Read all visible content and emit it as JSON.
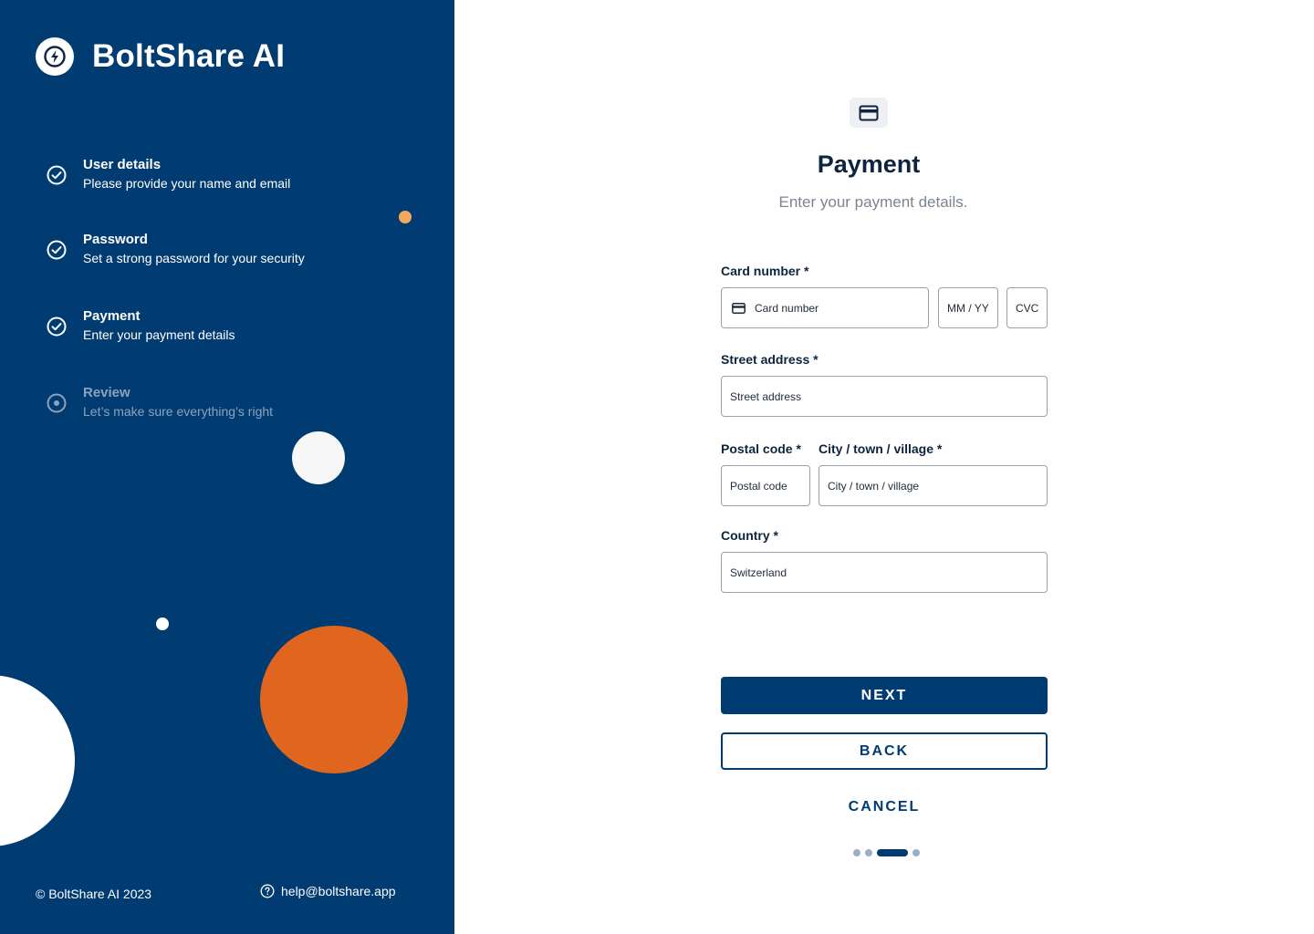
{
  "brand": {
    "name": "BoltShare AI",
    "logo_icon": "bolt-icon"
  },
  "steps": [
    {
      "title": "User details",
      "description": "Please provide your name and email",
      "status": "complete",
      "icon": "check-circle-icon"
    },
    {
      "title": "Password",
      "description": "Set a strong password for your security",
      "status": "complete",
      "icon": "check-circle-icon"
    },
    {
      "title": "Payment",
      "description": "Enter your payment details",
      "status": "complete",
      "icon": "check-circle-icon"
    },
    {
      "title": "Review",
      "description": "Let’s make sure everything’s right",
      "status": "inactive",
      "icon": "radio-dot-icon"
    }
  ],
  "footer": {
    "copyright": "© BoltShare AI 2023",
    "email": "help@boltshare.app"
  },
  "form": {
    "header_icon": "credit-card-icon",
    "title": "Payment",
    "subtitle": "Enter your payment details.",
    "card_number": {
      "label": "Card number *",
      "placeholder": "Card number"
    },
    "expiry": {
      "placeholder": "MM / YY"
    },
    "cvc": {
      "placeholder": "CVC"
    },
    "street": {
      "label": "Street address *",
      "placeholder": "Street address"
    },
    "postal": {
      "label": "Postal code *",
      "placeholder": "Postal code"
    },
    "city": {
      "label": "City / town / village *",
      "placeholder": "City / town / village"
    },
    "country": {
      "label": "Country *",
      "value": "Switzerland"
    }
  },
  "actions": {
    "next": "NEXT",
    "back": "BACK",
    "cancel": "CANCEL"
  },
  "pagination": {
    "total": 4,
    "current": 3
  },
  "colors": {
    "sidebar": "#003b71",
    "accent_orange": "#e0651e",
    "light_orange": "#f5a75f",
    "text_dark": "#0d2440"
  }
}
